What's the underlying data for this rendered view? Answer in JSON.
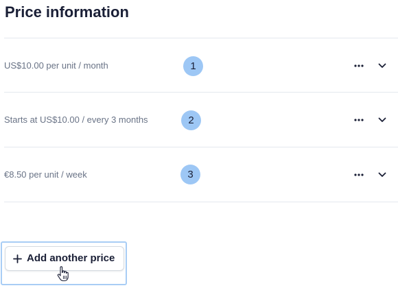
{
  "header": {
    "title": "Price information"
  },
  "prices": [
    {
      "badge": "1",
      "text": "US$10.00 per unit / month"
    },
    {
      "badge": "2",
      "text": "Starts at US$10.00 / every 3 months"
    },
    {
      "badge": "3",
      "text": "€8.50 per unit / week"
    }
  ],
  "actions": {
    "add_label": "Add another price"
  },
  "icons": {
    "more": "more-horizontal-icon",
    "expand": "chevron-down-icon",
    "add": "plus-icon",
    "cursor": "hand-pointer-icon"
  },
  "colors": {
    "badge": "#9dc7f5",
    "focus_outline": "#a8cdf5",
    "text_primary": "#1a1f36",
    "text_secondary": "#697386",
    "divider": "#e3e8ee"
  }
}
